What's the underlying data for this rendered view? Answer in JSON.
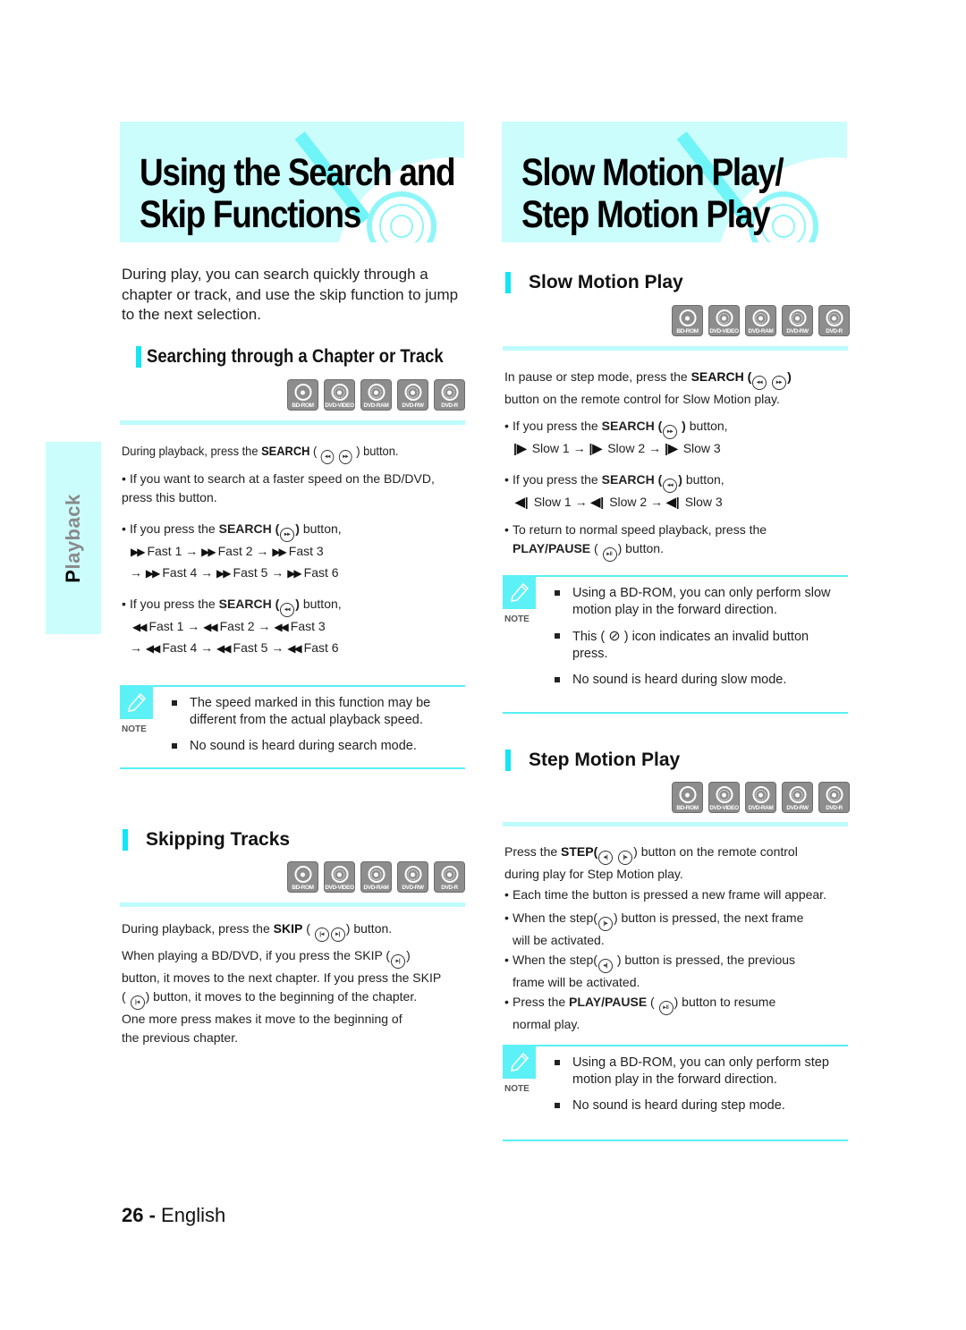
{
  "left_banner": {
    "title_line1": "Using the Search and",
    "title_line2": "Skip Functions"
  },
  "right_banner": {
    "title_line1": "Slow Motion Play/",
    "title_line2": "Step Motion Play"
  },
  "side_tab": {
    "label_first": "P",
    "label_rest": "layback"
  },
  "intro": "During play, you can search quickly through a chapter or track, and use the skip function to jump to the next selection.",
  "disc_types": [
    "BD-ROM",
    "DVD-VIDEO",
    "DVD-RAM",
    "DVD-RW",
    "DVD-R"
  ],
  "search_section": {
    "heading": "Searching through a Chapter or Track",
    "instruction_pre": "During playback, press the ",
    "instruction_bold": "SEARCH",
    "instruction_post": " button.",
    "bullet1": "If you want to search at a faster speed on the BD/DVD, press this button.",
    "fwd_intro_pre": "If you press the ",
    "fwd_intro_bold": "SEARCH (",
    "fwd_intro_bold2": ")",
    "fwd_intro_post": " button,",
    "fwd_steps": [
      "Fast 1",
      "Fast 2",
      "Fast 3",
      "Fast 4",
      "Fast 5",
      "Fast 6"
    ],
    "rev_intro_pre": "If you press the ",
    "rev_intro_bold": "SEARCH (",
    "rev_intro_bold2": ")",
    "rev_intro_post": " button,",
    "rev_steps": [
      "Fast 1",
      "Fast 2",
      "Fast 3",
      "Fast 4",
      "Fast 5",
      "Fast 6"
    ],
    "note_label": "NOTE",
    "notes": [
      "The speed marked in this function may be different from the actual playback speed.",
      "No sound is heard during search mode."
    ]
  },
  "skip_section": {
    "heading": "Skipping Tracks",
    "instruction_pre": "During playback, press the ",
    "instruction_bold": "SKIP",
    "instruction_post": " button.",
    "para_a": "When playing a BD/DVD, if you press the SKIP (",
    "para_b": ")",
    "para_c": "button, it moves to the next chapter. If you press the SKIP",
    "para_d": "button, it moves to the beginning of the chapter.",
    "para_e": "One more press makes it move to the beginning of",
    "para_f": "the previous chapter."
  },
  "slow_section": {
    "heading": "Slow Motion Play",
    "instr_pre": "In pause or step mode, press the ",
    "instr_bold": "SEARCH (",
    "instr_bold2": ")",
    "instr_line2": "button on the remote control for Slow Motion play.",
    "fwd_intro_pre": "If you press the ",
    "fwd_intro_bold": "SEARCH (",
    "fwd_intro_bold2": ")",
    "fwd_intro_post": " button,",
    "fwd_steps": [
      "Slow 1",
      "Slow 2",
      "Slow 3"
    ],
    "rev_intro_pre": "If you press the ",
    "rev_intro_bold": "SEARCH (",
    "rev_intro_bold2": ")",
    "rev_intro_post": " button,",
    "rev_steps": [
      "Slow 1",
      "Slow 2",
      "Slow 3"
    ],
    "return_line1": "To return to normal speed playback, press the",
    "return_bold": "PLAY/PAUSE",
    "return_post": " button.",
    "note_label": "NOTE",
    "note1": "Using a BD-ROM, you can only perform slow motion play in the forward direction.",
    "note2_pre": "This (",
    "note2_post": ") icon indicates an invalid button press.",
    "note3": "No sound is heard during slow mode."
  },
  "step_section": {
    "heading": "Step Motion Play",
    "instr_pre": "Press the ",
    "instr_bold": "STEP(",
    "instr_post": ") button on the remote control",
    "instr_line2": "during play for Step Motion play.",
    "bullet1": "Each time the button is pressed a new frame will appear.",
    "bullet2_pre": "When the step(",
    "bullet2_post": ") button is pressed, the next frame",
    "bullet2_line2": "will be activated.",
    "bullet3_pre": "When the step(",
    "bullet3_post": ") button is pressed, the previous",
    "bullet3_line2": "frame will be activated.",
    "bullet4_pre": "Press the ",
    "bullet4_bold": "PLAY/PAUSE",
    "bullet4_post": " button to resume",
    "bullet4_line2": "normal play.",
    "note_label": "NOTE",
    "notes": [
      "Using a BD-ROM, you can only perform step motion play in the forward direction.",
      "No sound is heard during step mode."
    ]
  },
  "footer": {
    "page_number": "26",
    "separator": " - ",
    "language": "English"
  },
  "colors": {
    "accent_cyan": "#11e6f2",
    "banner_bg": "#cbfdfd",
    "disc_icon_gray": "#8d8d8d"
  }
}
